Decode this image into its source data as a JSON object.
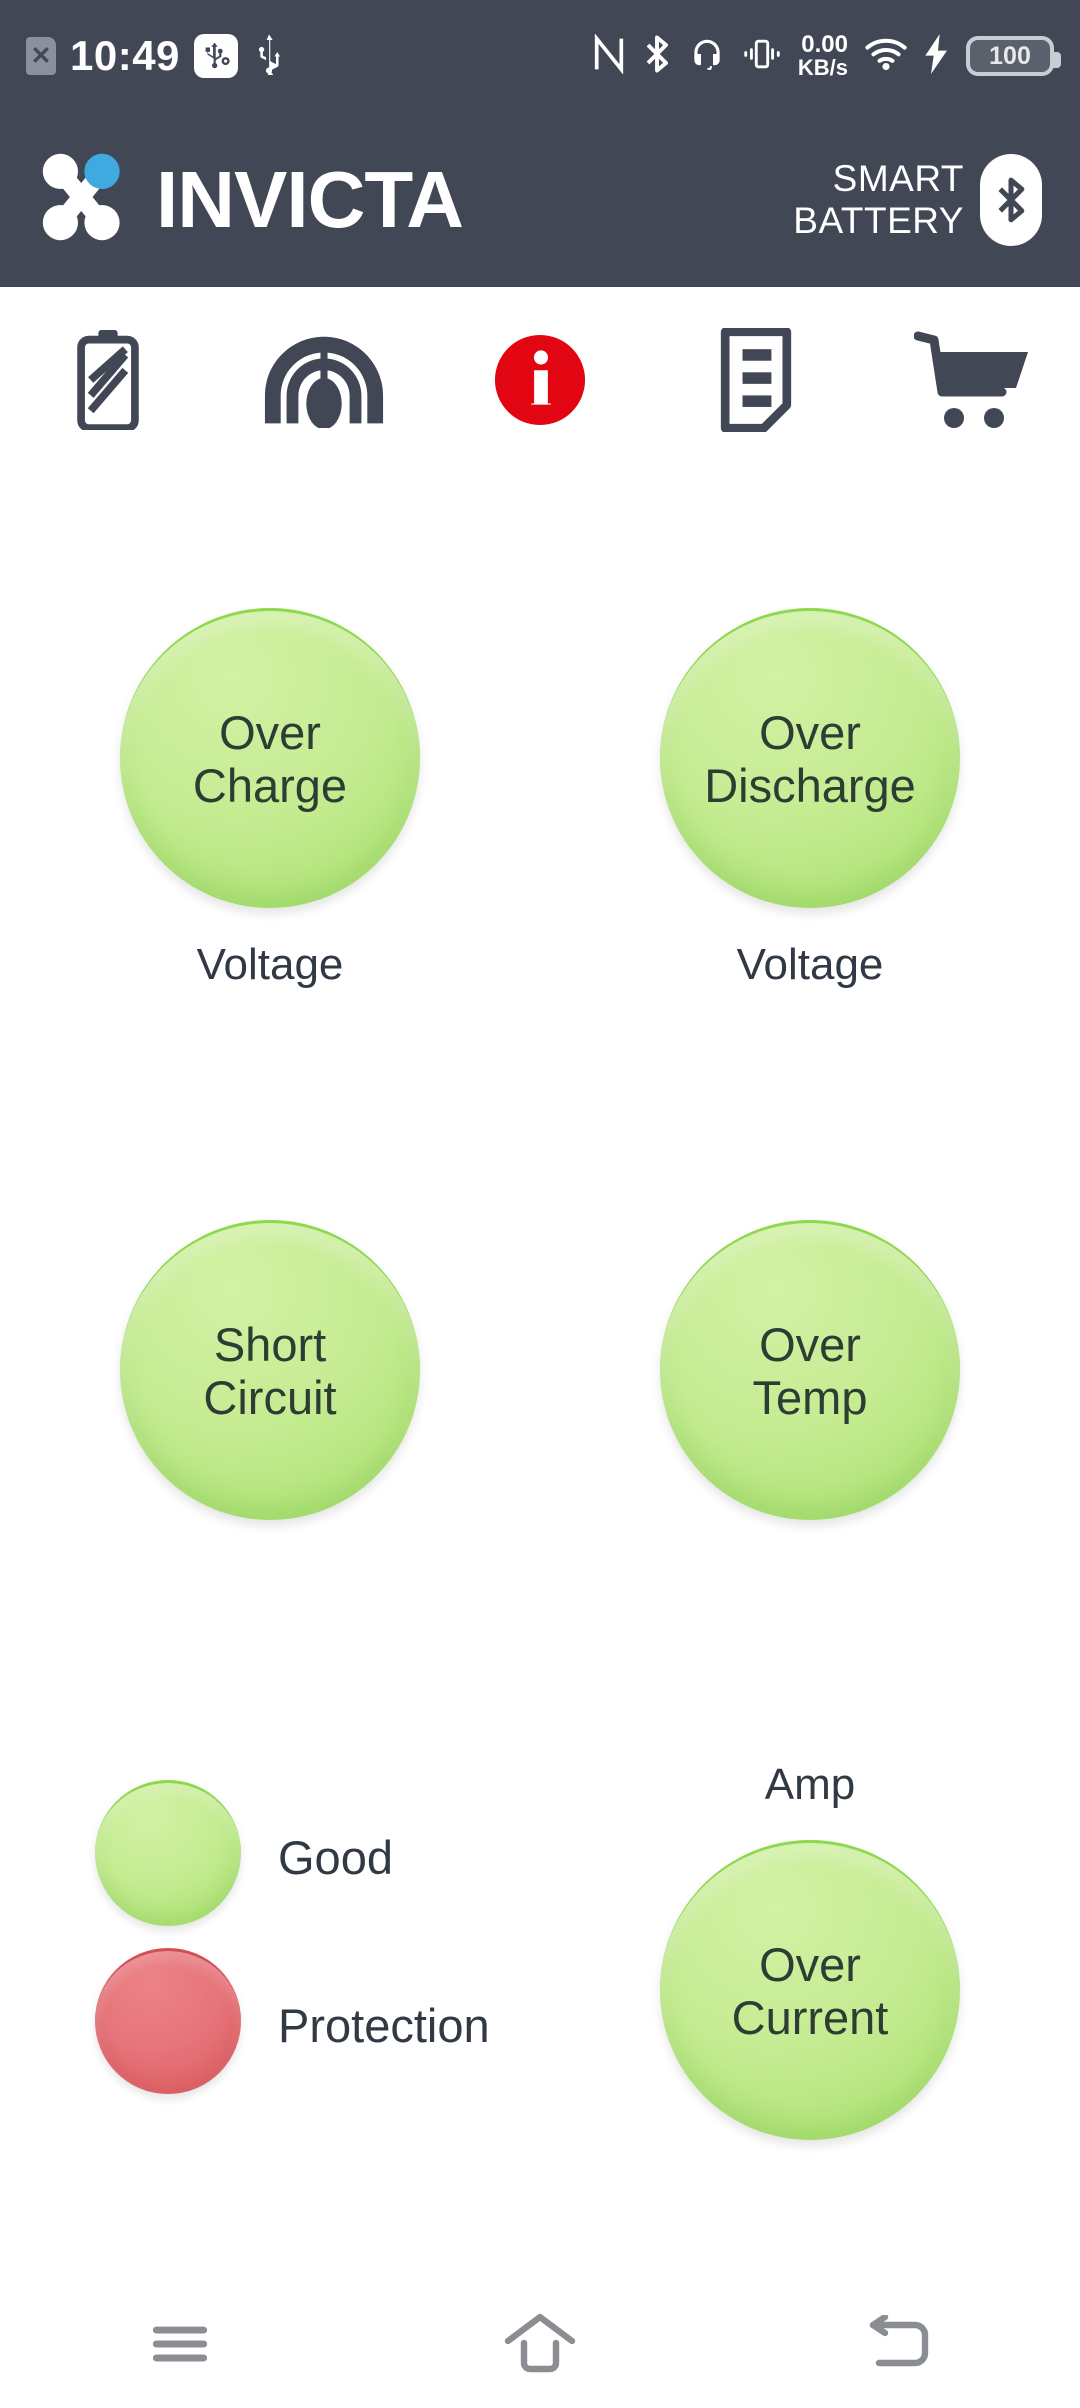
{
  "statusbar": {
    "sim_x": "✕",
    "time": "10:49",
    "icons_left": [
      "sim-card-disabled-icon",
      "usb-debug-icon",
      "usb-icon"
    ],
    "nfc": "nfc-icon",
    "bluetooth": "bluetooth-icon",
    "headset": "headset-icon",
    "vibrate": "vibrate-icon",
    "net_speed_value": "0.00",
    "net_speed_unit": "KB/s",
    "wifi": "wifi-icon",
    "charging": "charging-bolt-icon",
    "battery_level": "100"
  },
  "header": {
    "brand": "INVICTA",
    "logo": "invicta-molecule-logo",
    "smart_line1": "SMART",
    "smart_line2": "BATTERY",
    "bluetooth_badge": "bluetooth-icon"
  },
  "iconnav": {
    "items": [
      {
        "name": "battery-icon",
        "label": "Battery"
      },
      {
        "name": "gauge-icon",
        "label": "Gauge"
      },
      {
        "name": "info-icon",
        "label": "Info",
        "active": true
      },
      {
        "name": "document-icon",
        "label": "Report"
      },
      {
        "name": "cart-icon",
        "label": "Store"
      }
    ],
    "active_index": 2,
    "active_color": "#e20613"
  },
  "status": {
    "items": [
      {
        "id": "over-charge",
        "line1": "Over",
        "line2": "Charge",
        "state": "good",
        "caption": "Voltage",
        "caption_pos": "below"
      },
      {
        "id": "over-discharge",
        "line1": "Over",
        "line2": "Discharge",
        "state": "good",
        "caption": "Voltage",
        "caption_pos": "below"
      },
      {
        "id": "short-circuit",
        "line1": "Short",
        "line2": "Circuit",
        "state": "good",
        "caption": "",
        "caption_pos": "none"
      },
      {
        "id": "over-temp",
        "line1": "Over",
        "line2": "Temp",
        "state": "good",
        "caption": "",
        "caption_pos": "none"
      },
      {
        "id": "over-current",
        "line1": "Over",
        "line2": "Current",
        "state": "good",
        "caption": "Amp",
        "caption_pos": "above"
      }
    ]
  },
  "legend": {
    "good_label": "Good",
    "protection_label": "Protection"
  },
  "navbar": {
    "recents": "menu-icon",
    "home": "home-icon",
    "back": "back-icon"
  },
  "colors": {
    "header_bg": "#414755",
    "good_green": "#aee275",
    "protection_red": "#e6757b",
    "accent_red": "#e20613",
    "logo_blue": "#3fa9e0",
    "text_dark": "#313945"
  }
}
